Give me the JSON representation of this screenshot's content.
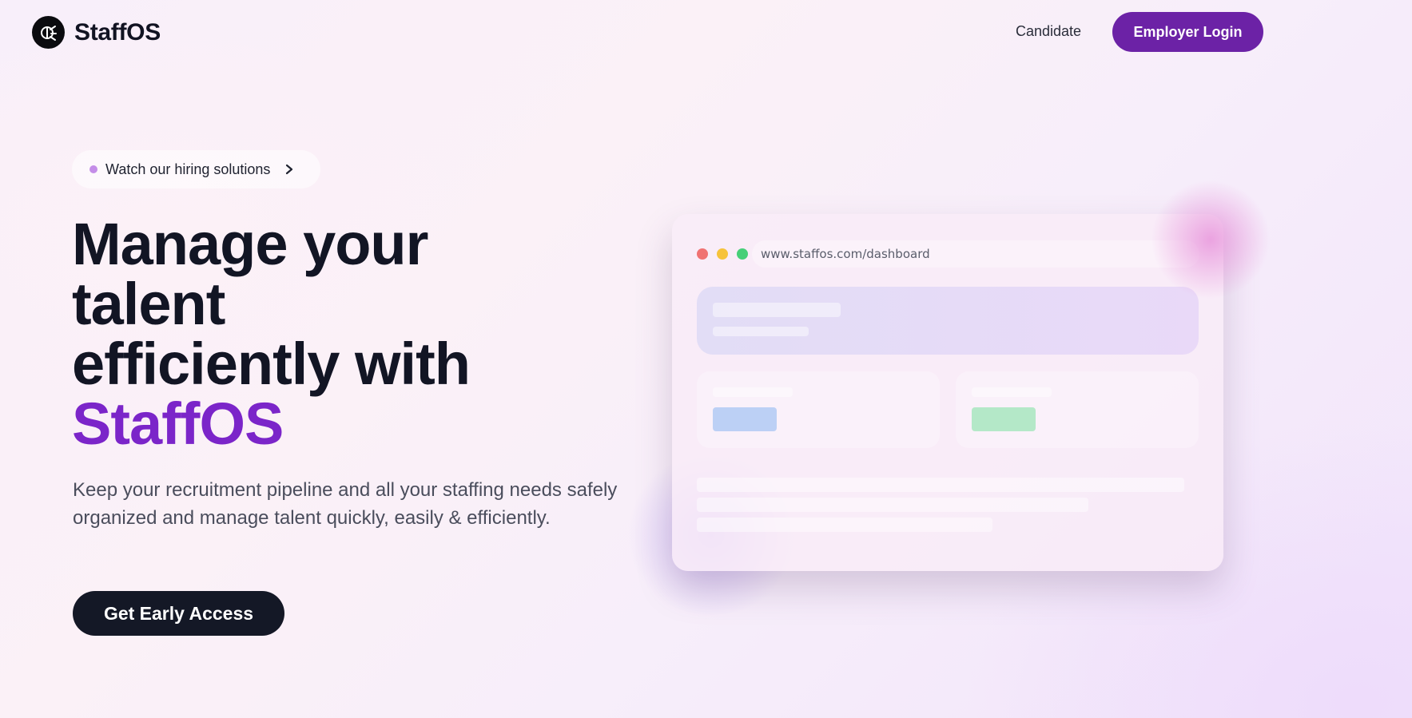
{
  "header": {
    "brand_name": "StaffOS",
    "nav": {
      "candidate_label": "Candidate",
      "employer_login_label": "Employer Login"
    }
  },
  "hero": {
    "pill_text": "Watch our hiring solutions",
    "headline_lines": [
      "Manage your",
      "talent",
      "efficiently with"
    ],
    "headline_brand": "StaffOS",
    "subtext": "Keep your recruitment pipeline and all your staffing needs safely organized and manage talent quickly, easily & efficiently.",
    "cta_label": "Get Early Access"
  },
  "preview": {
    "url": "www.staffos.com/dashboard"
  },
  "colors": {
    "primary_purple": "#6c22a6",
    "brand_text_purple": "#7b25c9",
    "dark": "#141826"
  },
  "icons": {
    "logo": "staffos-logo-icon",
    "pill_dot": "status-dot-icon",
    "pill_chevron": "chevron-right-icon"
  }
}
